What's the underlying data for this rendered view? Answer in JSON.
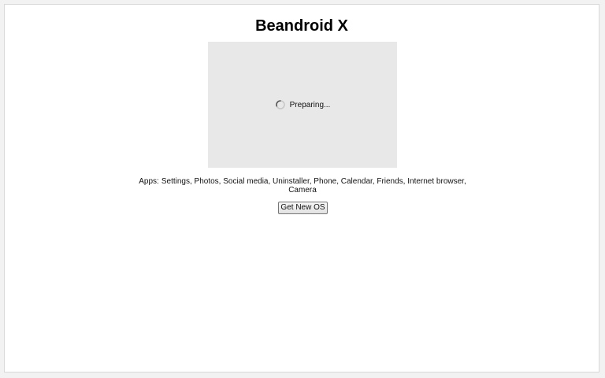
{
  "page": {
    "title": "Beandroid X"
  },
  "screen": {
    "status_text": "Preparing...",
    "spinner_icon": "loading-spinner-icon"
  },
  "apps": {
    "label": "Apps:",
    "list_text": "Settings, Photos, Social media, Uninstaller, Phone, Calendar, Friends, Internet browser, Camera"
  },
  "actions": {
    "get_new_os_label": "Get New OS"
  },
  "colors": {
    "screen_background": "#e8e8e8",
    "page_background": "#ffffff"
  }
}
